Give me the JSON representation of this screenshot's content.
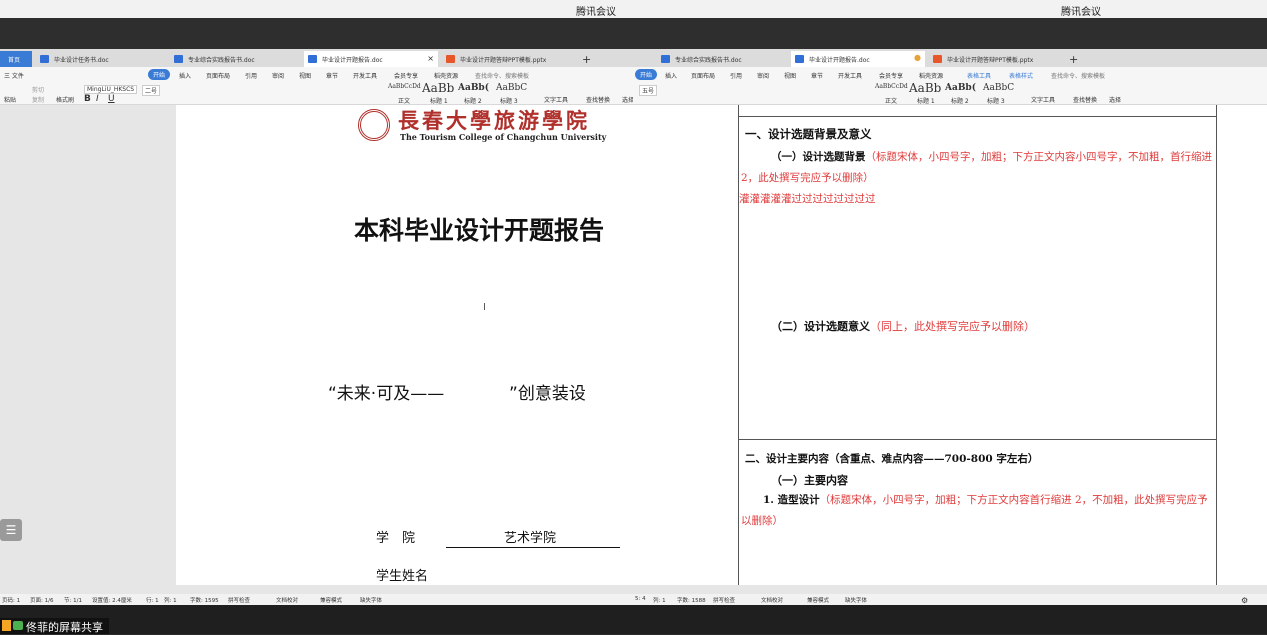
{
  "app": {
    "left_title": "腾讯会议",
    "right_title": "腾讯会议",
    "share_label": "佟菲的屏幕共享"
  },
  "left": {
    "tabs": [
      {
        "label": "首页"
      },
      {
        "label": "毕业设计任务书.doc"
      },
      {
        "label": "专业综合实践报告书.doc"
      },
      {
        "label": "毕业设计开题报告.doc"
      },
      {
        "label": "毕业设计开题答辩PPT模板.pptx"
      }
    ],
    "menu": [
      "三 文件",
      "开始",
      "插入",
      "页面布局",
      "引用",
      "审阅",
      "视图",
      "章节",
      "开发工具",
      "会员专享",
      "稻壳资源",
      "查找命令、搜索模板"
    ],
    "toolbar": {
      "paste": "粘贴",
      "cut": "剪切",
      "copy": "复制",
      "format_painter": "格式刷",
      "font": "MingLiU_HKSCS",
      "size": "二号",
      "text_tools": "文字工具",
      "find_replace": "查找替换",
      "select": "选择"
    },
    "styles": [
      {
        "preview": "AaBbCcDd",
        "name": "正文"
      },
      {
        "preview": "AaBb",
        "name": "标题 1"
      },
      {
        "preview": "AaBb(",
        "name": "标题 2"
      },
      {
        "preview": "AaBbC",
        "name": "标题 3"
      }
    ],
    "doc": {
      "school_cn": "長春大學旅游學院",
      "school_en": "The Tourism College of Changchun University",
      "title": "本科毕业设计开题报告",
      "subtitle": "“未来·可及——            ”创意装设",
      "college_label": "学　院",
      "college_value": "艺术学院",
      "student_label": "学生姓名"
    },
    "status": [
      "页码: 1",
      "页面: 1/6",
      "节: 1/1",
      "设置值: 2.4厘米",
      "行: 1",
      "列: 1",
      "字数: 1595",
      "拼写检查",
      "文档校对",
      "兼容模式",
      "缺失字体"
    ]
  },
  "right": {
    "tabs": [
      {
        "label": "专业综合实践报告书.doc"
      },
      {
        "label": "毕业设计开题报告.doc"
      },
      {
        "label": "毕业设计开题答辩PPT模板.pptx"
      }
    ],
    "menu": [
      "开始",
      "插入",
      "页面布局",
      "引用",
      "审阅",
      "视图",
      "章节",
      "开发工具",
      "会员专享",
      "稻壳资源",
      "表格工具",
      "表格样式",
      "查找命令、搜索模板"
    ],
    "toolbar": {
      "size": "五号",
      "text_tools": "文字工具",
      "find_replace": "查找替换",
      "select": "选择"
    },
    "styles": [
      {
        "preview": "AaBbCcDd",
        "name": "正文"
      },
      {
        "preview": "AaBb",
        "name": "标题 1"
      },
      {
        "preview": "AaBb(",
        "name": "标题 2"
      },
      {
        "preview": "AaBbC",
        "name": "标题 3"
      }
    ],
    "doc": {
      "sec1_title": "一、设计选题背景及意义",
      "sec1_sub1": "（一）设计选题背景",
      "sec1_sub1_note": "（标题宋体，小四号字，加粗；下方正文内容小四号字，不加粗，首行缩进 2，此处撰写完应予以删除）",
      "typed_text": "灌灌灌灌灌过过过过过过过过",
      "sec1_sub2": "（二）设计选题意义",
      "sec1_sub2_note": "（同上，此处撰写完应予以删除）",
      "sec2_title": "二、设计主要内容（含重点、难点内容——700-800 字左右）",
      "sec2_sub1": "（一）主要内容",
      "item1": "1. 造型设计",
      "item1_note": "（标题宋体，小四号字，加粗；下方正文内容首行缩进 2，不加粗，此处撰写完应予以删除）"
    },
    "status": [
      "5: 4",
      "列: 1",
      "字数: 1588",
      "拼写检查",
      "文档校对",
      "兼容模式",
      "缺失字体"
    ]
  },
  "colors": {
    "accent": "#3a7bd5",
    "red_note": "#e03b3b",
    "word_icon": "#2f6fd6",
    "ppt_icon": "#e8572a"
  }
}
